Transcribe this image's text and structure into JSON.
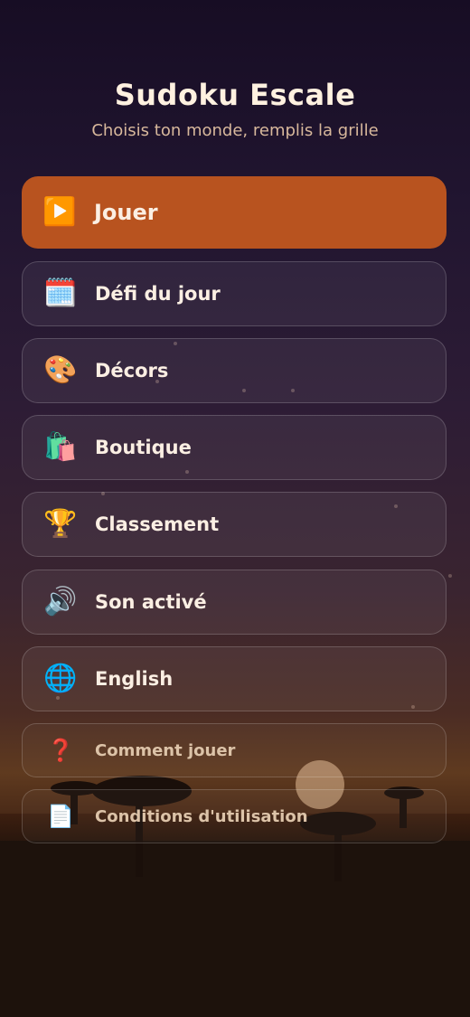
{
  "header": {
    "title": "Sudoku Escale",
    "subtitle": "Choisis ton monde, remplis la grille"
  },
  "menu": {
    "play": {
      "label": "Jouer",
      "icon": "play-icon",
      "glyph": "▶️"
    },
    "items": [
      {
        "label": "Défi du jour",
        "icon": "calendar-icon",
        "glyph": "🗓️"
      },
      {
        "label": "Décors",
        "icon": "palette-icon",
        "glyph": "🎨"
      },
      {
        "label": "Boutique",
        "icon": "shopping-bags-icon",
        "glyph": "🛍️"
      },
      {
        "label": "Classement",
        "icon": "trophy-icon",
        "glyph": "🏆"
      },
      {
        "label": "Son activé",
        "icon": "speaker-icon",
        "glyph": "🔊"
      },
      {
        "label": "English",
        "icon": "globe-icon",
        "glyph": "🌐"
      }
    ],
    "secondary": [
      {
        "label": "Comment jouer",
        "icon": "question-icon",
        "glyph": "❓"
      },
      {
        "label": "Conditions d'utilisation",
        "icon": "document-icon",
        "glyph": "📄"
      }
    ]
  },
  "colors": {
    "accent": "#b8531f",
    "title": "#fff1e0",
    "subtitle": "#d8b89c"
  }
}
